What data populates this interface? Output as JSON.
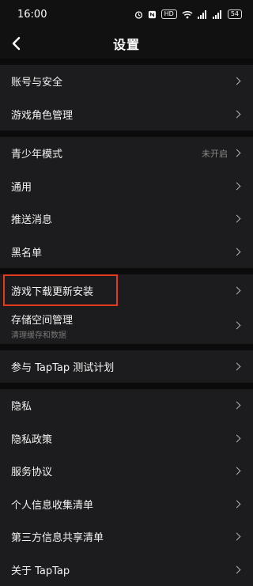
{
  "status_bar": {
    "time": "16:00",
    "icons": [
      "alarm-icon",
      "nfc-icon",
      "hd-icon",
      "wifi-icon",
      "signal-icon",
      "signal-icon",
      "battery-icon"
    ],
    "hd_label": "HD",
    "battery_level": "54"
  },
  "header": {
    "title": "设置"
  },
  "groups": [
    {
      "items": [
        {
          "label": "账号与安全"
        },
        {
          "label": "游戏角色管理"
        }
      ]
    },
    {
      "items": [
        {
          "label": "青少年模式",
          "value": "未开启"
        },
        {
          "label": "通用"
        },
        {
          "label": "推送消息"
        },
        {
          "label": "黑名单"
        }
      ]
    },
    {
      "items": [
        {
          "label": "游戏下载更新安装"
        },
        {
          "label": "存储空间管理",
          "sub": "清理缓存和数据"
        }
      ]
    },
    {
      "items": [
        {
          "label": "参与 TapTap 测试计划"
        }
      ]
    },
    {
      "items": [
        {
          "label": "隐私"
        },
        {
          "label": "隐私政策"
        },
        {
          "label": "服务协议"
        },
        {
          "label": "个人信息收集清单"
        },
        {
          "label": "第三方信息共享清单"
        },
        {
          "label": "关于 TapTap"
        }
      ]
    }
  ],
  "colors": {
    "background": "#111111",
    "row_background": "#1c1c1e",
    "highlight_border": "#e23a1f"
  }
}
